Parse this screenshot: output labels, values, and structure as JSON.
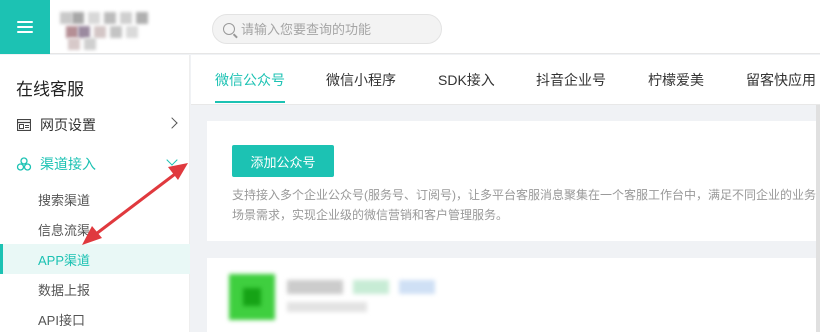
{
  "search": {
    "placeholder": "请输入您要查询的功能"
  },
  "sidebar": {
    "title": "在线客服",
    "items": [
      {
        "label": "网页设置",
        "icon": "webpage-icon"
      },
      {
        "label": "渠道接入",
        "icon": "channels-icon"
      }
    ],
    "sub_items": [
      {
        "label": "搜索渠道"
      },
      {
        "label": "信息流渠"
      },
      {
        "label": "APP渠道"
      },
      {
        "label": "数据上报"
      },
      {
        "label": "API接口"
      }
    ]
  },
  "tabs": [
    {
      "label": "微信公众号"
    },
    {
      "label": "微信小程序"
    },
    {
      "label": "SDK接入"
    },
    {
      "label": "抖音企业号"
    },
    {
      "label": "柠檬爱美"
    },
    {
      "label": "留客快应用"
    }
  ],
  "card": {
    "button_label": "添加公众号",
    "description": "支持接入多个企业公众号(服务号、订阅号)，让多平台客服消息聚集在一个客服工作台中，满足不同企业的业务场景需求，实现企业级的微信营销和客户管理服务。"
  },
  "colors": {
    "accent": "#1cc2b3",
    "annotation": "#e0393e"
  }
}
